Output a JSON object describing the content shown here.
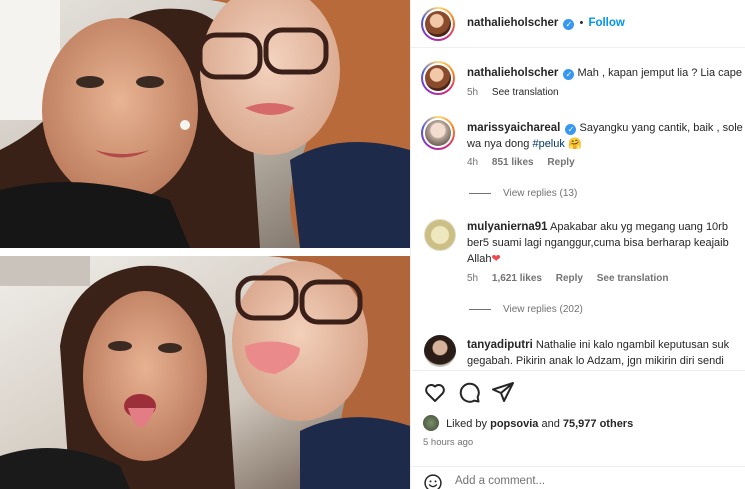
{
  "post": {
    "author": "nathalieholscher",
    "follow_label": "Follow",
    "dot": "•"
  },
  "comments": [
    {
      "user": "nathalieholscher",
      "verified": true,
      "text": "Mah , kapan jemput lia ? Lia cape",
      "time": "5h",
      "see_translation": "See translation"
    },
    {
      "user": "marissyaichareal",
      "verified": true,
      "text_line1": "Sayangku yang cantik, baik , sole",
      "text_line2_prefix": "wa nya dong",
      "hashtag": "#peluk",
      "emoji": "🤗",
      "time": "4h",
      "likes": "851 likes",
      "reply": "Reply",
      "view_replies": "View replies (13)"
    },
    {
      "user": "mulyanierna91",
      "text_line1": "Apakabar aku yg megang uang 10rb",
      "text_line2": "ber5 suami lagi nganggur,cuma bisa berharap keajaib",
      "text_line3": "Allah",
      "heart": "❤",
      "time": "5h",
      "likes": "1,621 likes",
      "reply": "Reply",
      "see_translation": "See translation",
      "view_replies": "View replies (202)"
    },
    {
      "user": "tanyadiputri",
      "text_line1": "Nathalie ini kalo ngambil keputusan suk",
      "text_line2": "gegabah. Pikirin anak lo Adzam, jgn mikirin diri sendi"
    }
  ],
  "actions": {
    "icons": [
      "heart-icon",
      "comment-icon",
      "share-icon"
    ],
    "liked_by_prefix": "Liked by",
    "liked_by_user": "popsovia",
    "liked_by_and": "and",
    "liked_by_count": "75,977 others",
    "posted": "5 hours ago"
  },
  "add_comment": {
    "placeholder": "Add a comment..."
  },
  "colors": {
    "link_blue": "#0095f6",
    "verified_blue": "#3897f0",
    "secondary_text": "#737373",
    "hashtag": "#00376b",
    "heart_red": "#ed4956"
  }
}
